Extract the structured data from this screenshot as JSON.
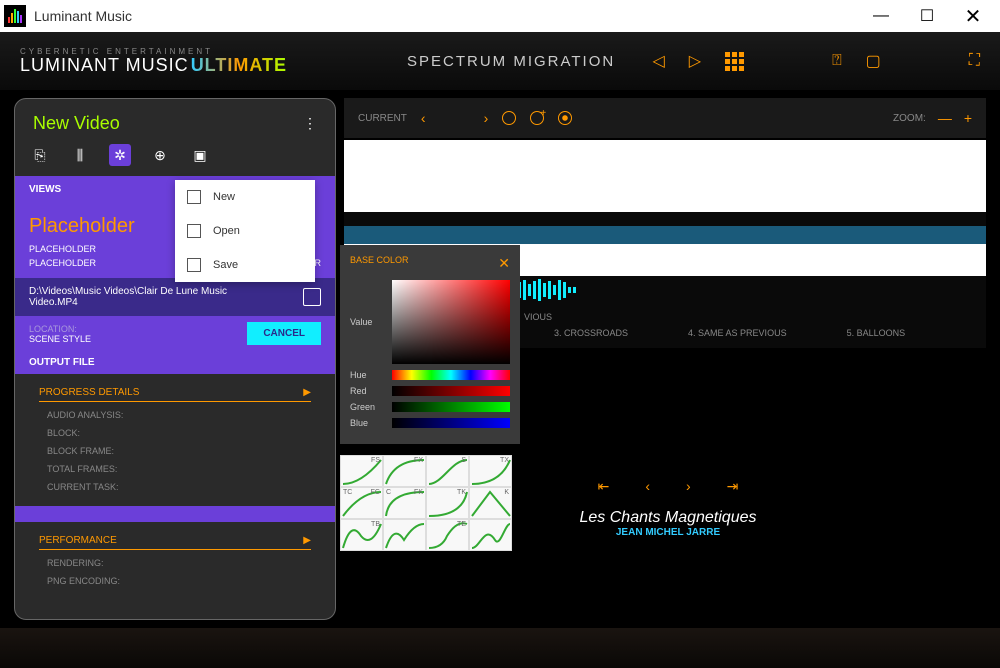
{
  "window": {
    "title": "Luminant Music"
  },
  "brand": {
    "tagline": "CYBERNETIC ENTERTAINMENT",
    "name": "LUMINANT MUSIC",
    "edition": "ULTIMATE"
  },
  "header": {
    "section_title": "SPECTRUM MIGRATION"
  },
  "sidebar": {
    "title": "New Video",
    "views_label": "VIEWS",
    "placeholder_big": "Placeholder",
    "ph1": "PLACEHOLDER",
    "ph2": "PLACEHOLDER",
    "ph3": "PLACEHOLDER",
    "file_path": "D:\\Videos\\Music Videos\\Clair De Lune Music Video.MP4",
    "location_lbl": "LOCATION:",
    "scene_lbl": "SCENE STYLE",
    "cancel": "CANCEL",
    "output_lbl": "OUTPUT FILE",
    "progress_hdr": "PROGRESS DETAILS",
    "progress_items": [
      "AUDIO ANALYSIS:",
      "BLOCK:",
      "BLOCK FRAME:",
      "TOTAL FRAMES:",
      "CURRENT TASK:"
    ],
    "perf_hdr": "PERFORMANCE",
    "perf_items": [
      "RENDERING:",
      "PNG ENCODING:"
    ]
  },
  "context_menu": {
    "items": [
      "New",
      "Open",
      "Save"
    ]
  },
  "timeline": {
    "current_lbl": "CURRENT",
    "zoom_lbl": "ZOOM:",
    "previous_lbl": "VIOUS",
    "scenes": [
      "3. CROSSROADS",
      "4. SAME AS PREVIOUS",
      "5. BALLOONS"
    ]
  },
  "color_picker": {
    "title": "BASE COLOR",
    "labels": {
      "value": "Value",
      "hue": "Hue",
      "red": "Red",
      "green": "Green",
      "blue": "Blue"
    }
  },
  "curves": {
    "row1": [
      "FS",
      "FX",
      "S",
      "TX"
    ],
    "row2": [
      "FC",
      "TC",
      "FK",
      "C",
      "TK",
      "K"
    ],
    "row3": [
      "TB",
      "",
      "TE",
      ""
    ]
  },
  "now_playing": {
    "title": "Les Chants Magnetiques",
    "artist": "JEAN MICHEL JARRE"
  }
}
